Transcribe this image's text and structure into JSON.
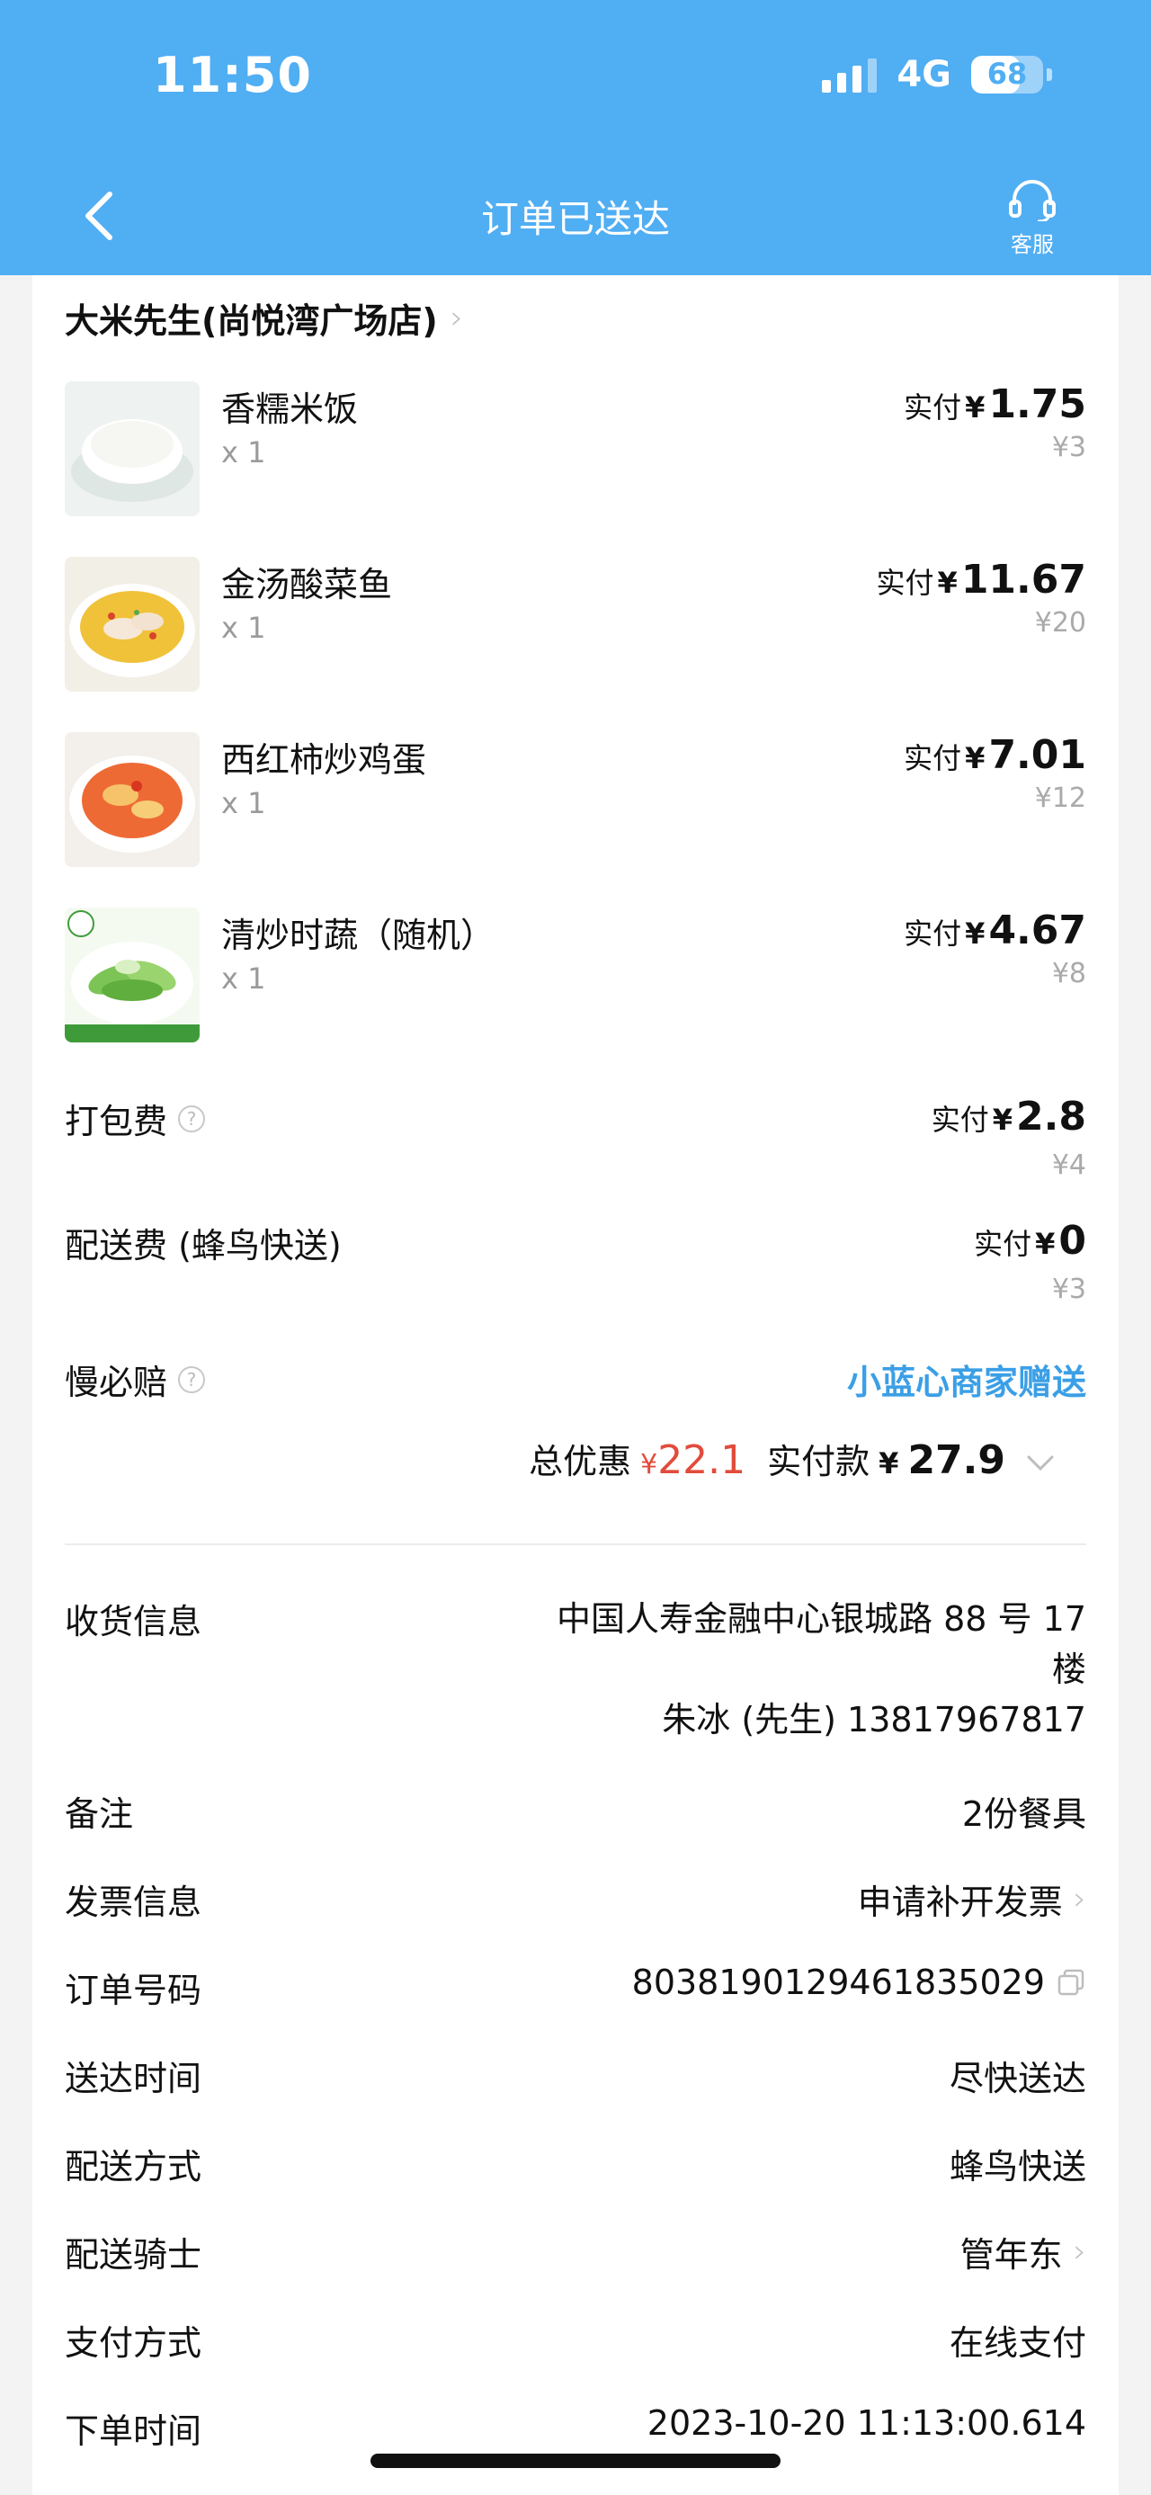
{
  "status_bar": {
    "time": "11:50",
    "network": "4G",
    "battery": "68",
    "battery_level": 0.68
  },
  "nav": {
    "title": "订单已送达",
    "service_label": "客服"
  },
  "shop": {
    "name": "大米先生(尚悦湾广场店)"
  },
  "dishes": [
    {
      "name": "香糯米饭",
      "qty": "x 1",
      "pay_label": "实付",
      "currency": "¥",
      "paid": "1.75",
      "original": "¥3"
    },
    {
      "name": "金汤酸菜鱼",
      "qty": "x 1",
      "pay_label": "实付",
      "currency": "¥",
      "paid": "11.67",
      "original": "¥20"
    },
    {
      "name": "西红柿炒鸡蛋",
      "qty": "x 1",
      "pay_label": "实付",
      "currency": "¥",
      "paid": "7.01",
      "original": "¥12"
    },
    {
      "name": "清炒时蔬（随机）",
      "qty": "x 1",
      "pay_label": "实付",
      "currency": "¥",
      "paid": "4.67",
      "original": "¥8"
    }
  ],
  "fees": {
    "packing": {
      "label": "打包费",
      "pay_label": "实付",
      "currency": "¥",
      "paid": "2.8",
      "original": "¥4"
    },
    "delivery": {
      "label": "配送费 (蜂鸟快送)",
      "pay_label": "实付",
      "currency": "¥",
      "paid": "0",
      "original": "¥3"
    },
    "slow": {
      "label": "慢必赔",
      "value": "小蓝心商家赠送"
    }
  },
  "summary": {
    "discount_label": "总优惠",
    "discount_currency": "¥",
    "discount": "22.1",
    "total_label": "实付款",
    "total_currency": "¥",
    "total": "27.9"
  },
  "info": {
    "address": {
      "label": "收货信息",
      "line1": "中国人寿金融中心银城路 88 号 17",
      "line2": "楼",
      "contact": "朱冰 (先生) 13817967817"
    },
    "note": {
      "label": "备注",
      "value": "2份餐具"
    },
    "invoice": {
      "label": "发票信息",
      "value": "申请补开发票"
    },
    "order_no": {
      "label": "订单号码",
      "value": "8038190129461835029"
    },
    "delivery_time": {
      "label": "送达时间",
      "value": "尽快送达"
    },
    "delivery_method": {
      "label": "配送方式",
      "value": "蜂鸟快送"
    },
    "rider": {
      "label": "配送骑士",
      "value": "管年东"
    },
    "payment": {
      "label": "支付方式",
      "value": "在线支付"
    },
    "order_time": {
      "label": "下单时间",
      "value": "2023-10-20 11:13:00.614"
    }
  },
  "colors": {
    "header": "#50aef3",
    "accent_blue": "#3b9fe6",
    "discount_red": "#e24b3b"
  }
}
